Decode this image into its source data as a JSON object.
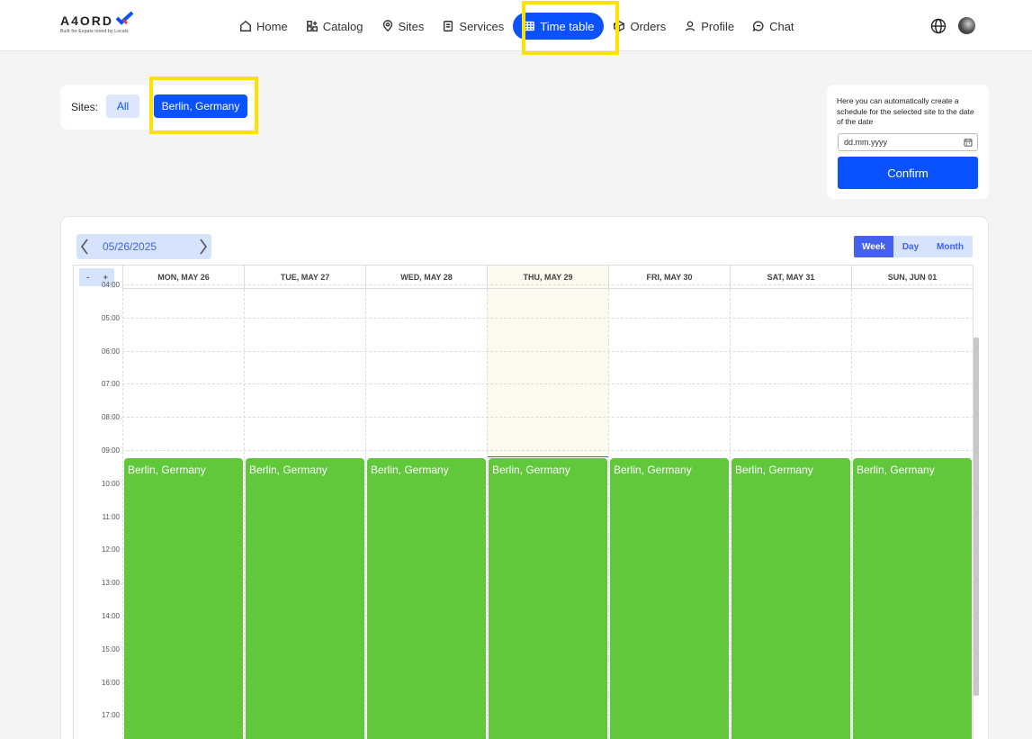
{
  "header": {
    "logo": {
      "text": "A4ORD",
      "tagline": "Built for Expats loved by Locals"
    },
    "nav": [
      {
        "label": "Home",
        "icon": "home-icon",
        "active": false
      },
      {
        "label": "Catalog",
        "icon": "catalog-icon",
        "active": false
      },
      {
        "label": "Sites",
        "icon": "location-pin-icon",
        "active": false
      },
      {
        "label": "Services",
        "icon": "services-icon",
        "active": false
      },
      {
        "label": "Time table",
        "icon": "table-icon",
        "active": true
      },
      {
        "label": "Orders",
        "icon": "box-icon",
        "active": false
      },
      {
        "label": "Profile",
        "icon": "user-icon",
        "active": false
      },
      {
        "label": "Chat",
        "icon": "chat-icon",
        "active": false
      }
    ],
    "language_icon": "globe-icon",
    "avatar_icon": "avatar"
  },
  "sites_filter": {
    "label": "Sites:",
    "options": [
      "All",
      "Berlin, Germany"
    ],
    "selected": "Berlin, Germany"
  },
  "schedule": {
    "description": "Here you can automatically create a schedule for the selected site to the date of the date",
    "date_placeholder": "dd.mm.yyyy",
    "confirm_label": "Confirm"
  },
  "calendar": {
    "current_date": "05/26/2025",
    "views": [
      "Week",
      "Day",
      "Month"
    ],
    "active_view": "Week",
    "zoom_out": "-",
    "zoom_in": "+",
    "days": [
      "MON, MAY 26",
      "TUE, MAY 27",
      "WED, MAY 28",
      "THU, MAY 29",
      "FRI, MAY 30",
      "SAT, MAY 31",
      "SUN, JUN 01"
    ],
    "today_index": 3,
    "hours": [
      "04:00",
      "05:00",
      "06:00",
      "07:00",
      "08:00",
      "09:00",
      "10:00",
      "11:00",
      "12:00",
      "13:00",
      "14:00",
      "15:00",
      "16:00",
      "17:00"
    ],
    "events": [
      {
        "day": 0,
        "title": "Berlin, Germany",
        "start": "09:15"
      },
      {
        "day": 1,
        "title": "Berlin, Germany",
        "start": "09:15"
      },
      {
        "day": 2,
        "title": "Berlin, Germany",
        "start": "09:15"
      },
      {
        "day": 3,
        "title": "Berlin, Germany",
        "start": "09:15"
      },
      {
        "day": 4,
        "title": "Berlin, Germany",
        "start": "09:15"
      },
      {
        "day": 5,
        "title": "Berlin, Germany",
        "start": "09:15"
      },
      {
        "day": 6,
        "title": "Berlin, Germany",
        "start": "09:15"
      }
    ],
    "event_color": "#61c83c",
    "accent_color": "#0a52ff"
  }
}
